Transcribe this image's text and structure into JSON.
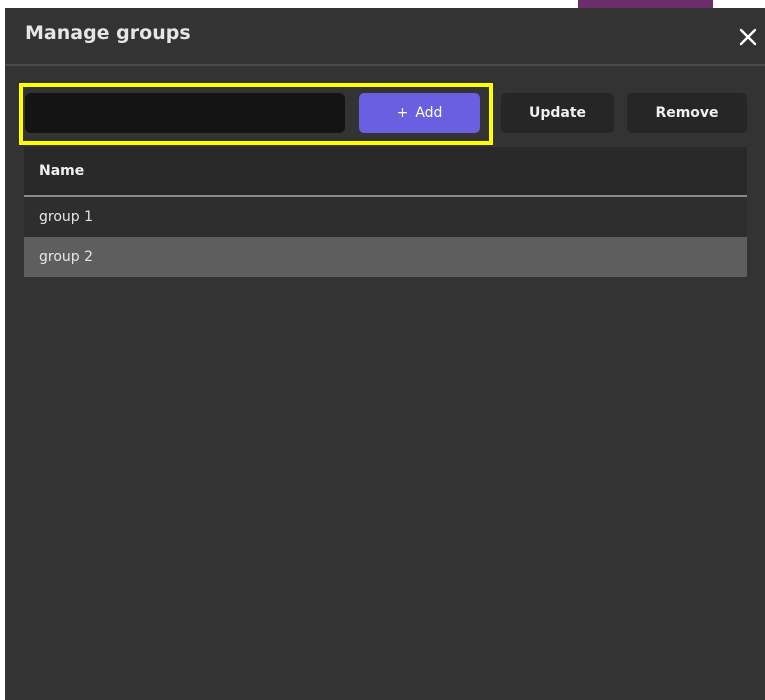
{
  "dialog": {
    "title": "Manage groups",
    "close_icon": "close-icon"
  },
  "toolbar": {
    "input_value": "",
    "input_placeholder": "",
    "add_label": "Add",
    "add_icon": "+",
    "update_label": "Update",
    "remove_label": "Remove"
  },
  "table": {
    "header": "Name",
    "rows": [
      {
        "name": "group 1",
        "selected": false
      },
      {
        "name": "group 2",
        "selected": true
      }
    ]
  },
  "colors": {
    "dialog_bg": "#333333",
    "accent": "#6a5fe0",
    "highlight": "#ffff00",
    "selected_row": "#5e5e5e"
  }
}
